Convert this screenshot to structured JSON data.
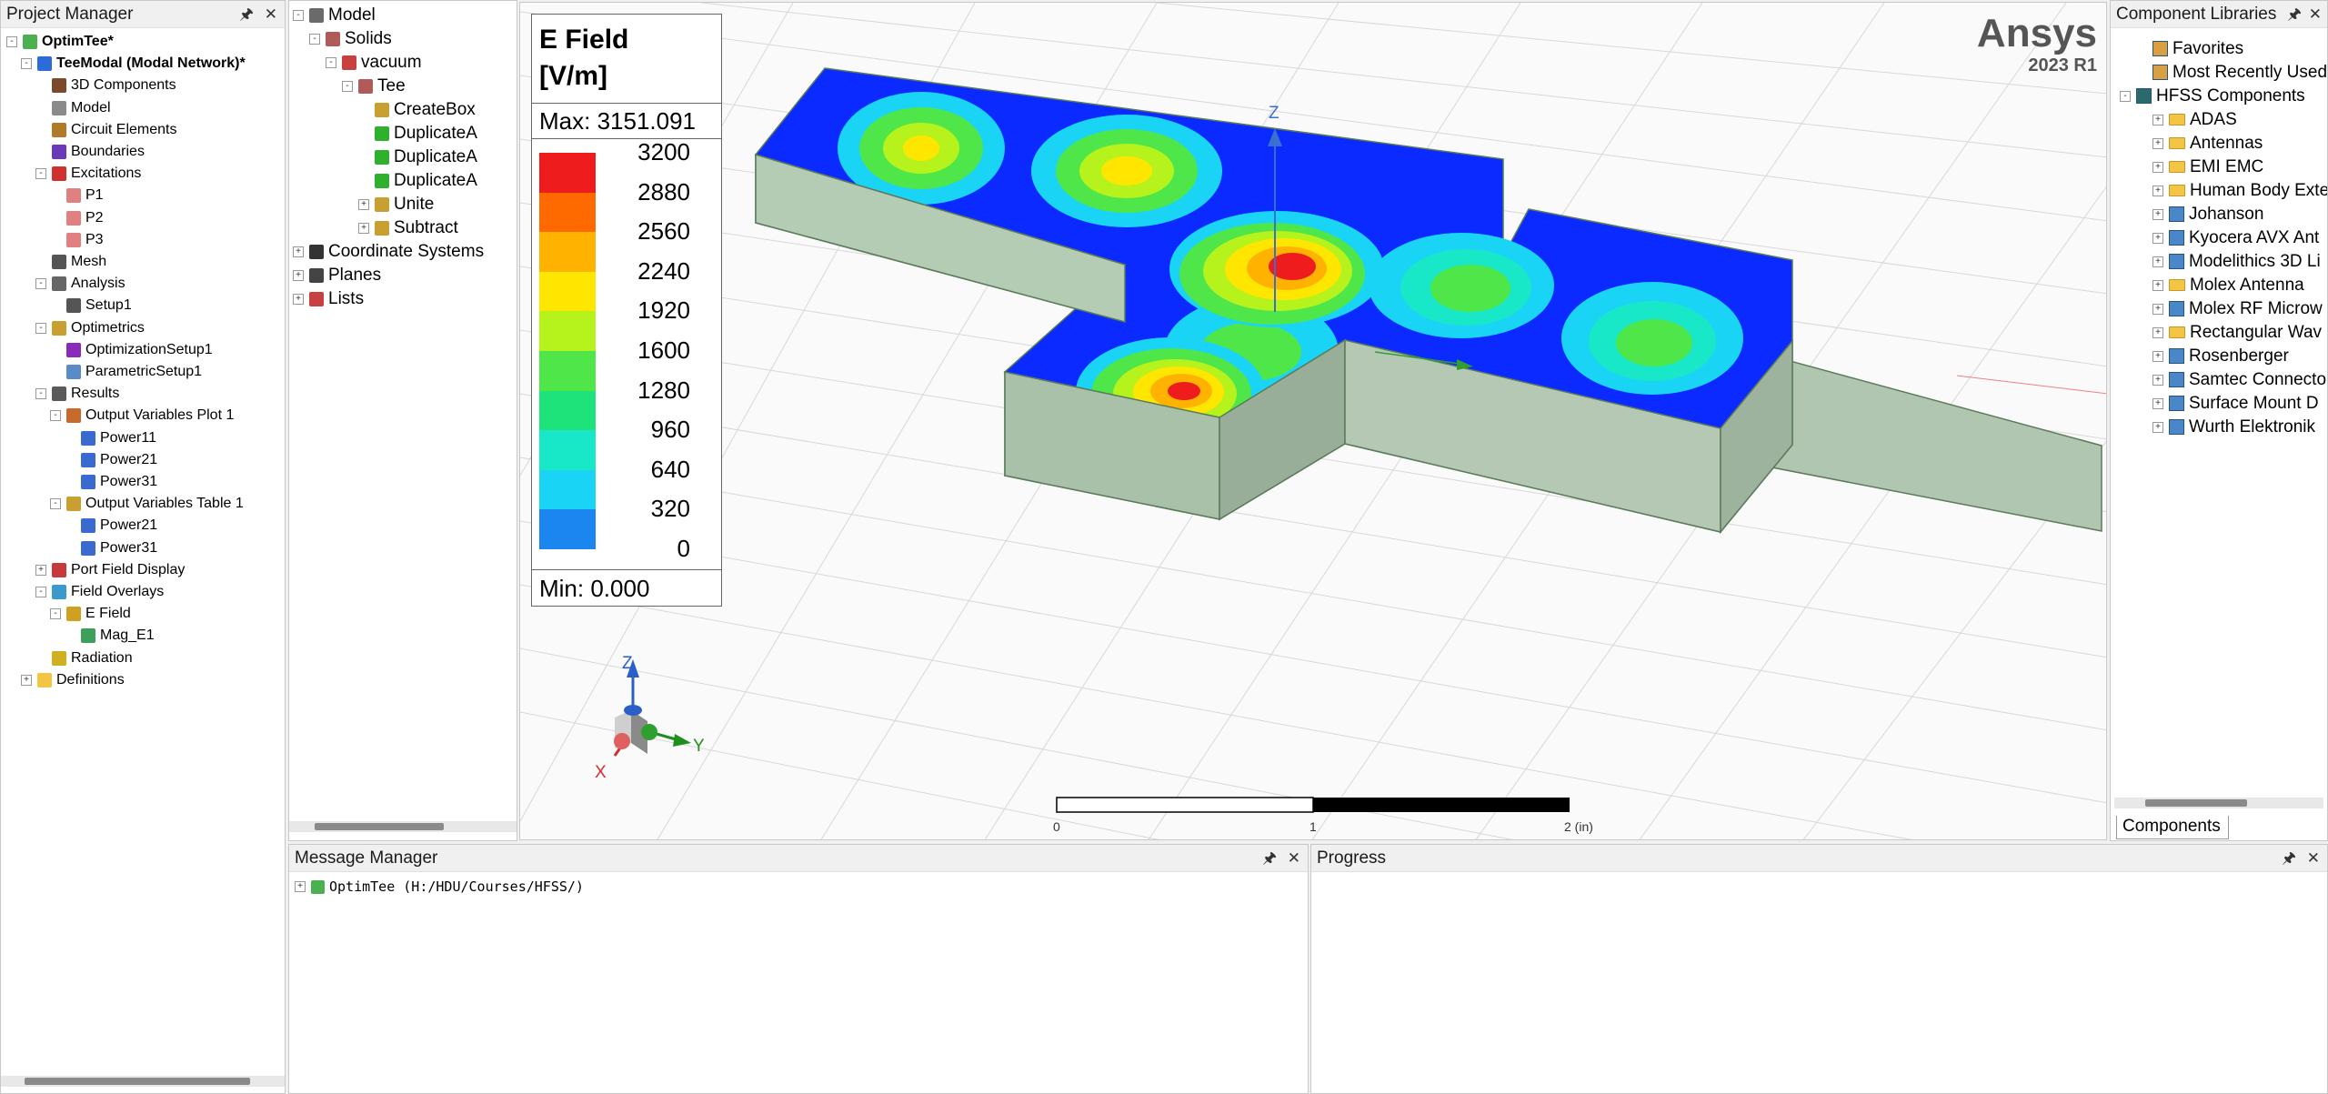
{
  "project_manager": {
    "title": "Project Manager",
    "tree": [
      {
        "label": "OptimTee*",
        "bold": true
      },
      {
        "label": "TeeModal (Modal Network)*",
        "bold": true
      },
      {
        "label": "3D Components"
      },
      {
        "label": "Model"
      },
      {
        "label": "Circuit Elements"
      },
      {
        "label": "Boundaries"
      },
      {
        "label": "Excitations"
      },
      {
        "label": "P1"
      },
      {
        "label": "P2"
      },
      {
        "label": "P3"
      },
      {
        "label": "Mesh"
      },
      {
        "label": "Analysis"
      },
      {
        "label": "Setup1"
      },
      {
        "label": "Optimetrics"
      },
      {
        "label": "OptimizationSetup1"
      },
      {
        "label": "ParametricSetup1"
      },
      {
        "label": "Results"
      },
      {
        "label": "Output Variables Plot 1"
      },
      {
        "label": "Power11"
      },
      {
        "label": "Power21"
      },
      {
        "label": "Power31"
      },
      {
        "label": "Output Variables Table 1"
      },
      {
        "label": "Power21"
      },
      {
        "label": "Power31"
      },
      {
        "label": "Port Field Display"
      },
      {
        "label": "Field Overlays"
      },
      {
        "label": "E Field"
      },
      {
        "label": "Mag_E1"
      },
      {
        "label": "Radiation"
      },
      {
        "label": "Definitions"
      }
    ]
  },
  "model_tree": {
    "items": [
      {
        "label": "Model"
      },
      {
        "label": "Solids"
      },
      {
        "label": "vacuum"
      },
      {
        "label": "Tee"
      },
      {
        "label": "CreateBox"
      },
      {
        "label": "DuplicateA"
      },
      {
        "label": "DuplicateA"
      },
      {
        "label": "DuplicateA"
      },
      {
        "label": "Unite"
      },
      {
        "label": "Subtract"
      },
      {
        "label": "Coordinate Systems"
      },
      {
        "label": "Planes"
      },
      {
        "label": "Lists"
      }
    ]
  },
  "legend": {
    "title": "E Field",
    "unit": "[V/m]",
    "max_label": "Max: 3151.091",
    "min_label": "Min:    0.000",
    "ticks": [
      "3200",
      "2880",
      "2560",
      "2240",
      "1920",
      "1600",
      "1280",
      "960",
      "640",
      "320",
      "0"
    ],
    "colors": [
      "#ee1c1c",
      "#ff6a00",
      "#ffb300",
      "#ffe600",
      "#b6f21c",
      "#4fe64a",
      "#1ee27a",
      "#19e8c8",
      "#1ad4f5",
      "#1b86f0",
      "#0a2aff"
    ]
  },
  "brand": {
    "name": "Ansys",
    "version": "2023 R1"
  },
  "scale_bar": {
    "ticks": [
      "0",
      "1",
      "2 (in)"
    ]
  },
  "axes": {
    "z": "Z",
    "y": "Y",
    "x": "X"
  },
  "component_libraries": {
    "title": "Component Libraries",
    "items": [
      {
        "label": "Favorites"
      },
      {
        "label": "Most Recently Used"
      },
      {
        "label": "HFSS Components"
      },
      {
        "label": "ADAS"
      },
      {
        "label": "Antennas"
      },
      {
        "label": "EMI EMC"
      },
      {
        "label": "Human Body Exte"
      },
      {
        "label": "Johanson"
      },
      {
        "label": "Kyocera AVX Ant"
      },
      {
        "label": "Modelithics 3D Li"
      },
      {
        "label": "Molex Antenna"
      },
      {
        "label": "Molex RF Microw"
      },
      {
        "label": "Rectangular Wav"
      },
      {
        "label": "Rosenberger"
      },
      {
        "label": "Samtec Connecto"
      },
      {
        "label": "Surface Mount D"
      },
      {
        "label": "Wurth Elektronik"
      }
    ],
    "tab": "Components"
  },
  "message_manager": {
    "title": "Message Manager",
    "entry": "OptimTee (H:/HDU/Courses/HFSS/)"
  },
  "progress": {
    "title": "Progress"
  }
}
